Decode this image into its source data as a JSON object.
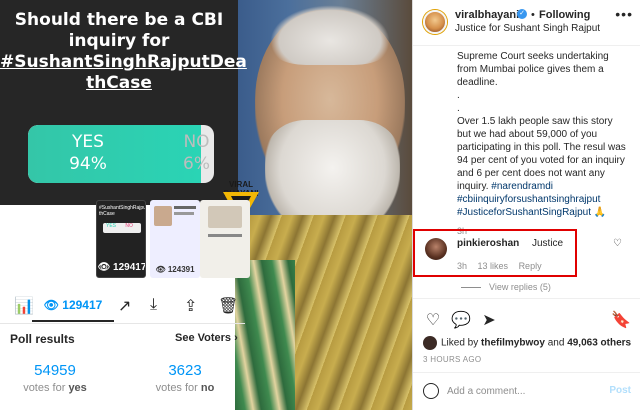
{
  "story": {
    "question_line1": "Should there be a CBI",
    "question_line2": "inquiry for",
    "question_tag": "#SushantSinghRajputDea",
    "question_tag2": "thCase",
    "yes_label": "YES",
    "yes_pct": "94%",
    "no_label": "NO",
    "no_pct": "6%",
    "yes_fraction": 0.94,
    "watermark": "VIRAL BHAYANI",
    "watermark_sub": "OFFICIAL APP"
  },
  "thumbs": {
    "t1_text": "#SushantSinghRajputDea thCase",
    "t1_yes": "YES",
    "t1_no": "NO",
    "t1_count": "129417",
    "t2_count": "124391"
  },
  "stats": {
    "views": "129417"
  },
  "poll_results": {
    "title": "Poll results",
    "see_voters": "See Voters",
    "yes_count": "54959",
    "yes_label_a": "votes for ",
    "yes_label_b": "yes",
    "no_count": "3623",
    "no_label_a": "votes for ",
    "no_label_b": "no"
  },
  "post": {
    "username": "viralbhayani",
    "verified_mark": "✓",
    "following": "Following",
    "location": "Justice for Sushant Singh Rajput",
    "more": "•••",
    "caption_lines": [
      "Supreme Court seeks undertaking",
      "from Mumbai police gives them a",
      "deadline.",
      ".",
      ".",
      "Over 1.5 lakh people saw this story",
      "but we had about 59,000 of you",
      "participating in this poll. The resul was",
      "94 per cent of you voted for an inquiry",
      "and 6 per cent does not want any",
      "inquiry."
    ],
    "tags": [
      "#narendramdi",
      "#cbiinquiryforsushantsinghrajput",
      "#JusticeforSushantSingRajput 🙏"
    ],
    "caption_age": "3h",
    "comment_user": "pinkieroshan",
    "comment_text": "Justice",
    "comment_age": "3h",
    "comment_likes": "13 likes",
    "comment_reply": "Reply",
    "view_replies": "View replies (5)",
    "liked_by": "Liked by ",
    "liked_user": "thefilmybwoy",
    "liked_and": " and ",
    "liked_others": "49,063 others",
    "posted_ago": "3 HOURS AGO",
    "comment_placeholder": "Add a comment...",
    "post_button": "Post"
  }
}
